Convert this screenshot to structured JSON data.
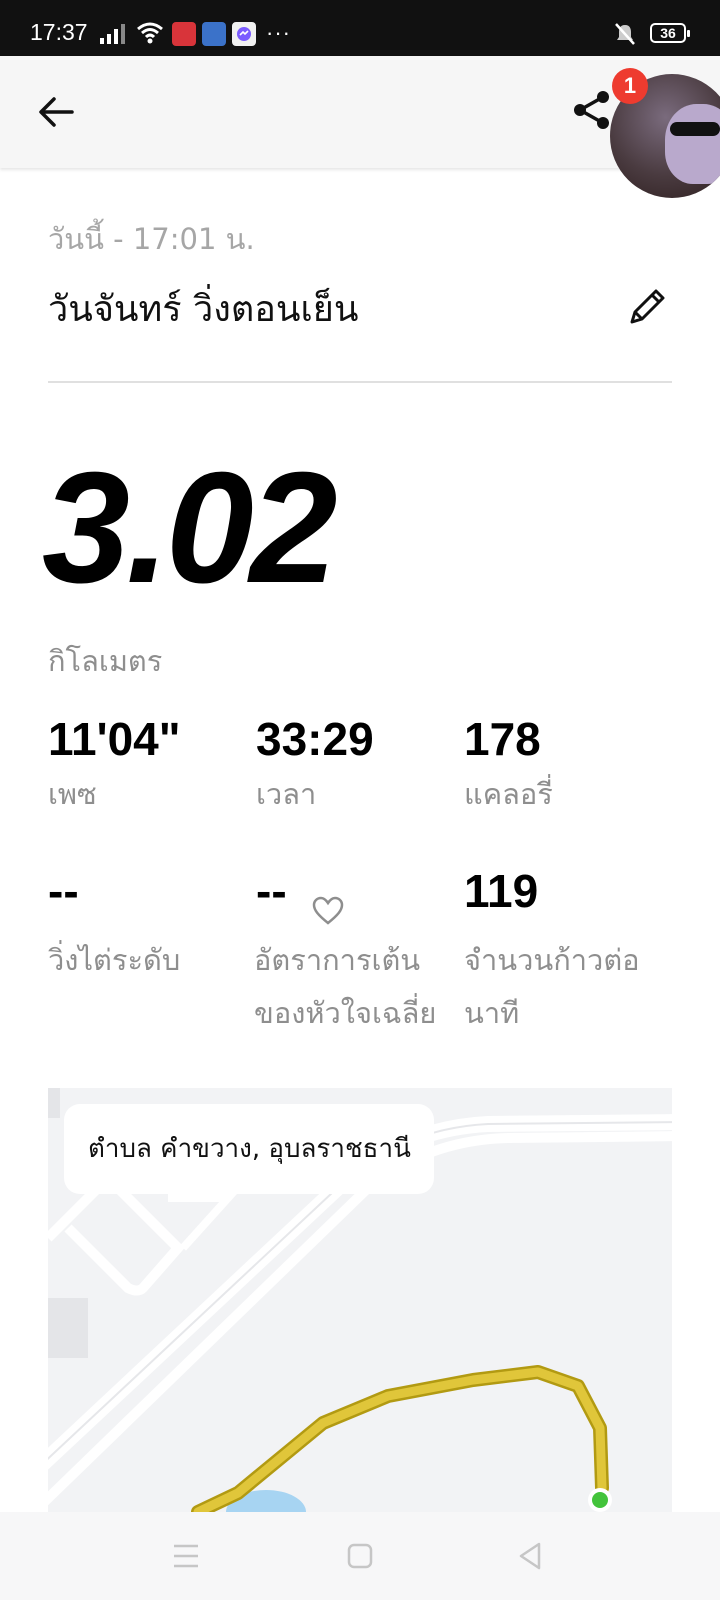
{
  "status_bar": {
    "time": "17:37",
    "overflow_dots": "···",
    "battery": "36",
    "icons": [
      "signal-icon",
      "wifi-icon",
      "notification-app-icon",
      "notification-app-icon",
      "messenger-icon",
      "mute-vibrate-icon",
      "battery-icon"
    ]
  },
  "header": {
    "notification_count": "1"
  },
  "activity": {
    "date_line": "วันนี้ - 17:01 น.",
    "title": "วันจันทร์ วิ่งตอนเย็น",
    "distance": "3.02",
    "distance_unit": "กิโลเมตร"
  },
  "stats": [
    {
      "value": "11'04\"",
      "label": "เพซ"
    },
    {
      "value": "33:29",
      "label": "เวลา"
    },
    {
      "value": "178",
      "label": "แคลอรี่"
    },
    {
      "value": "--",
      "label": "วิ่งไต่ระดับ"
    },
    {
      "value": "--",
      "label": "อัตราการเต้นของหัวใจเฉลี่ย"
    },
    {
      "value": "119",
      "label": "จำนวนก้าวต่อนาที"
    }
  ],
  "map": {
    "location": "ตำบล คำขวาง, อุบลราชธานี",
    "route_color": "#e0c63a"
  },
  "colors": {
    "badge": "#ee3b2f",
    "label_gray": "#8e8e8e"
  }
}
